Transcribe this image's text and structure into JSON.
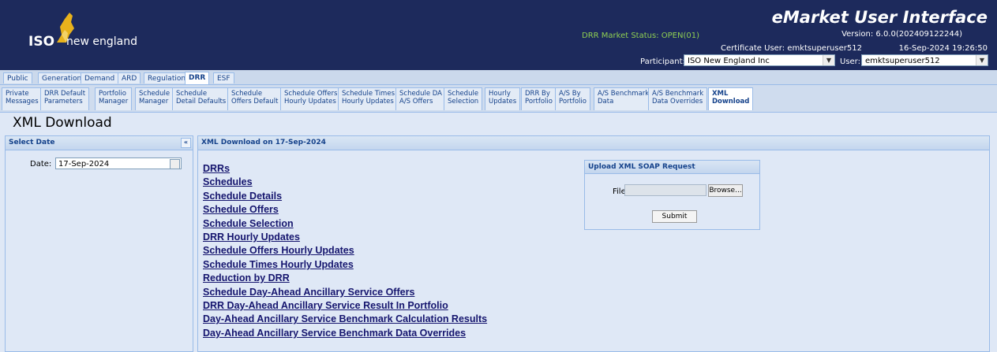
{
  "header": {
    "logo_iso": "ISO",
    "logo_name": "new england",
    "app_title": "eMarket User Interface",
    "version": "Version: 6.0.0(202409122244)",
    "market_status": "DRR Market Status: OPEN(01)",
    "certificate_user": "Certificate User: emktsuperuser512",
    "datetime": "16-Sep-2024 19:26:50",
    "participant_label": "Participant:",
    "participant_value": "ISO New England Inc",
    "user_label": "User:",
    "user_value": "emktsuperuser512"
  },
  "main_tabs": [
    "Public",
    "Generation",
    "Demand",
    "ARD",
    "Regulation",
    "DRR",
    "ESF"
  ],
  "active_main_tab": "DRR",
  "sub_tabs": [
    [
      "Private",
      "Messages"
    ],
    [
      "DRR Default",
      "Parameters"
    ],
    [
      "Portfolio",
      "Manager"
    ],
    [
      "Schedule",
      "Manager"
    ],
    [
      "Schedule",
      "Detail Defaults"
    ],
    [
      "Schedule",
      "Offers Default"
    ],
    [
      "Schedule Offers",
      "Hourly Updates"
    ],
    [
      "Schedule Times",
      "Hourly Updates"
    ],
    [
      "Schedule DA",
      "A/S Offers"
    ],
    [
      "Schedule",
      "Selection"
    ],
    [
      "Hourly",
      "Updates"
    ],
    [
      "DRR By",
      "Portfolio"
    ],
    [
      "A/S By",
      "Portfolio"
    ],
    [
      "A/S Benchmark",
      "Data"
    ],
    [
      "A/S Benchmark",
      "Data Overrides"
    ],
    [
      "XML",
      "Download"
    ]
  ],
  "page_title": "XML Download",
  "left_panel": {
    "title": "Select Date",
    "collapse_glyph": "«",
    "date_label": "Date:",
    "date_value": "17-Sep-2024"
  },
  "main_panel": {
    "title": "XML Download on 17-Sep-2024",
    "links": [
      "DRRs",
      "Schedules",
      "Schedule Details",
      "Schedule Offers",
      "Schedule Selection",
      "DRR Hourly Updates",
      "Schedule Offers Hourly Updates",
      "Schedule Times Hourly Updates",
      "Reduction by DRR",
      "Schedule Day-Ahead Ancillary Service Offers",
      "DRR Day-Ahead Ancillary Service Result In Portfolio",
      "Day-Ahead Ancillary Service Benchmark Calculation Results",
      "Day-Ahead Ancillary Service Benchmark Data Overrides"
    ]
  },
  "upload": {
    "title": "Upload XML SOAP Request",
    "file_label": "File:",
    "browse_label": "Browse...",
    "submit_label": "Submit"
  }
}
